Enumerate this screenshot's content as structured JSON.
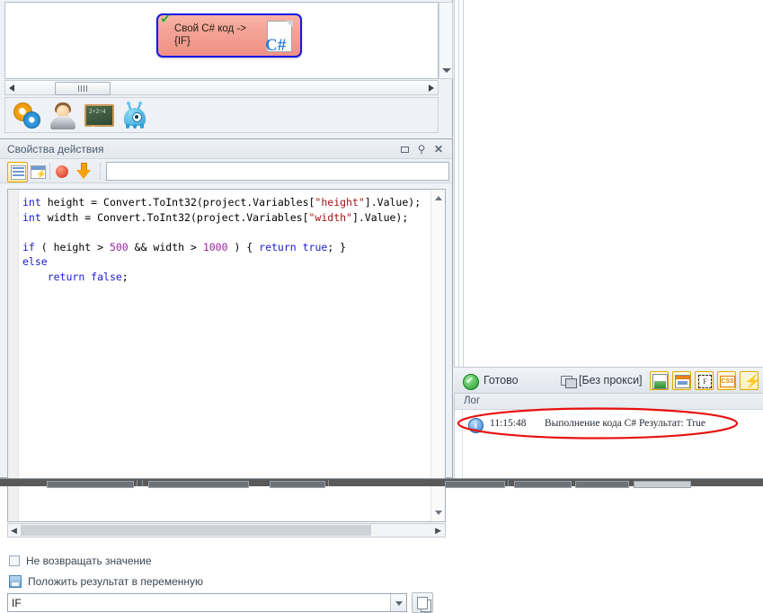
{
  "diagram": {
    "node": {
      "label": "Свой C# код ->\n{IF}",
      "status_icon": "green-check-icon",
      "type_icon": "csharp-file-icon",
      "border_color": "#1717e8",
      "fill_color": "#f4a195"
    },
    "toolbar_icons": [
      {
        "name": "gears-icon",
        "title": "Действия"
      },
      {
        "name": "person-icon",
        "title": "Пользователь"
      },
      {
        "name": "blackboard-icon",
        "title": "Обучение"
      },
      {
        "name": "alien-icon",
        "title": "Бот"
      }
    ],
    "hscroll_thumb_grip": "|||"
  },
  "properties_panel": {
    "title": "Свойства действия",
    "window_buttons": {
      "restore": "restore-icon",
      "pin": "pin-icon",
      "close": "✕"
    },
    "toolbar": {
      "grid_view": "grid-view-icon",
      "window_view": "window-view-icon",
      "stop": "stop-record-icon",
      "download": "download-arrow-icon",
      "search_value": "",
      "search_placeholder": ""
    },
    "code": {
      "lines": [
        "int height = Convert.ToInt32(project.Variables[\"height\"].Value);",
        "int width = Convert.ToInt32(project.Variables[\"width\"].Value);",
        "",
        "if ( height > 500 && width > 1000 ) { return true; }",
        "else",
        "    return false;"
      ],
      "colors": {
        "keyword": "#1b1bd8",
        "string": "#a31515",
        "number": "#a020a0",
        "plain": "#000000"
      }
    },
    "no_return_checkbox": {
      "label": "Не возвращать значение",
      "checked": false
    },
    "put_result_checkbox": {
      "label": "Положить результат в переменную",
      "checked": true
    },
    "variable_select": {
      "value": "IF",
      "dropdown_icon": "chevron-down-icon"
    },
    "copy_button": "copy-icon"
  },
  "right_panel": {
    "statusbar": {
      "status_icon": "green-check-circle-icon",
      "status_text": "Готово",
      "proxy_icon": "proxy-monitor-icon",
      "proxy_text": "[Без прокси]",
      "toggles": [
        {
          "name": "images-toggle",
          "label": "IMG"
        },
        {
          "name": "forms-toggle",
          "label": "FORM"
        },
        {
          "name": "frames-toggle",
          "label": "F"
        },
        {
          "name": "css-toggle",
          "label": "CSS"
        },
        {
          "name": "scripts-toggle",
          "label": "JS"
        }
      ]
    },
    "log": {
      "header": "Лог",
      "entries": [
        {
          "icon": "info-icon",
          "time": "11:15:48",
          "message": "Выполнение кода C#  Результат: True",
          "highlighted": true,
          "highlight_color": "#e81010"
        }
      ]
    }
  },
  "taskbar": {
    "background": "#595959"
  }
}
